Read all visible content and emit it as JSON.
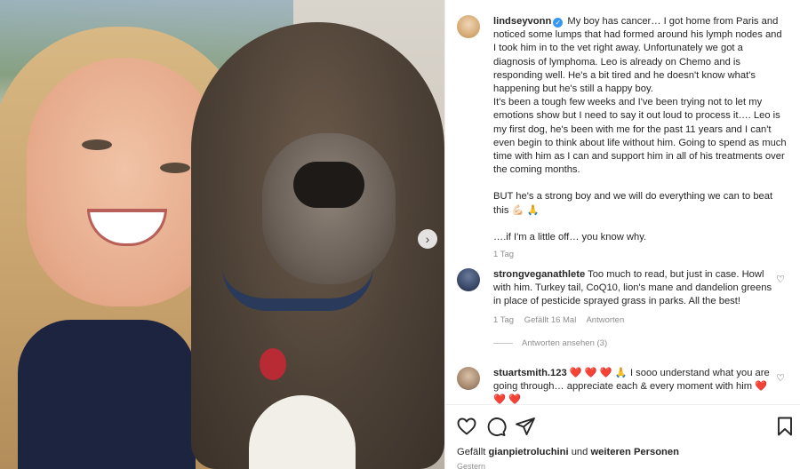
{
  "post": {
    "username": "lindseyvonn",
    "caption_paragraphs": [
      "My boy has cancer… I got home from Paris and noticed some lumps that had formed around his lymph nodes and I took him in to the vet right away. Unfortunately we got a diagnosis of lymphoma. Leo is already on Chemo and is responding well. He's a bit tired and he doesn't know what's happening but he's still a happy boy.",
      "It's been a tough few weeks and I've been trying not to let my emotions show but I need to say it out loud to process it…. Leo is my first dog, he's been with me for the past 11 years and I can't even begin to think about life without him. Going to spend as much time with him as I can and support him in all of his treatments over the coming months.",
      "BUT he's a strong boy and we will do everything we can to beat this 💪🏻 🙏",
      "….if I'm a little off… you know why."
    ],
    "time_ago": "1 Tag"
  },
  "comments": [
    {
      "username": "strongveganathlete",
      "text": "Too much to read, but just in case. Howl with him. Turkey tail, CoQ10, lion's mane and dandelion greens in place of pesticide sprayed grass in parks. All the best!",
      "time": "1 Tag",
      "likes": "Gefällt 16 Mal",
      "reply": "Antworten"
    },
    {
      "username": "stuartsmith.123",
      "text": "❤️ ❤️ ❤️ 🙏 I sooo understand what you are going through… appreciate each & every moment with him ❤️ ❤️ ❤️"
    }
  ],
  "view_replies": "Antworten ansehen (3)",
  "likes_line": {
    "prefix": "Gefällt",
    "user": "gianpietroluchini",
    "middle": "und",
    "suffix": "weiteren Personen"
  },
  "date": "Gestern",
  "icons": [
    "heart-icon",
    "comment-icon",
    "share-icon",
    "bookmark-icon",
    "verified-icon",
    "chevron-right-icon"
  ],
  "colors": {
    "verified": "#3897f0",
    "heart": "#ed4956",
    "muted": "#8e8e8e"
  }
}
